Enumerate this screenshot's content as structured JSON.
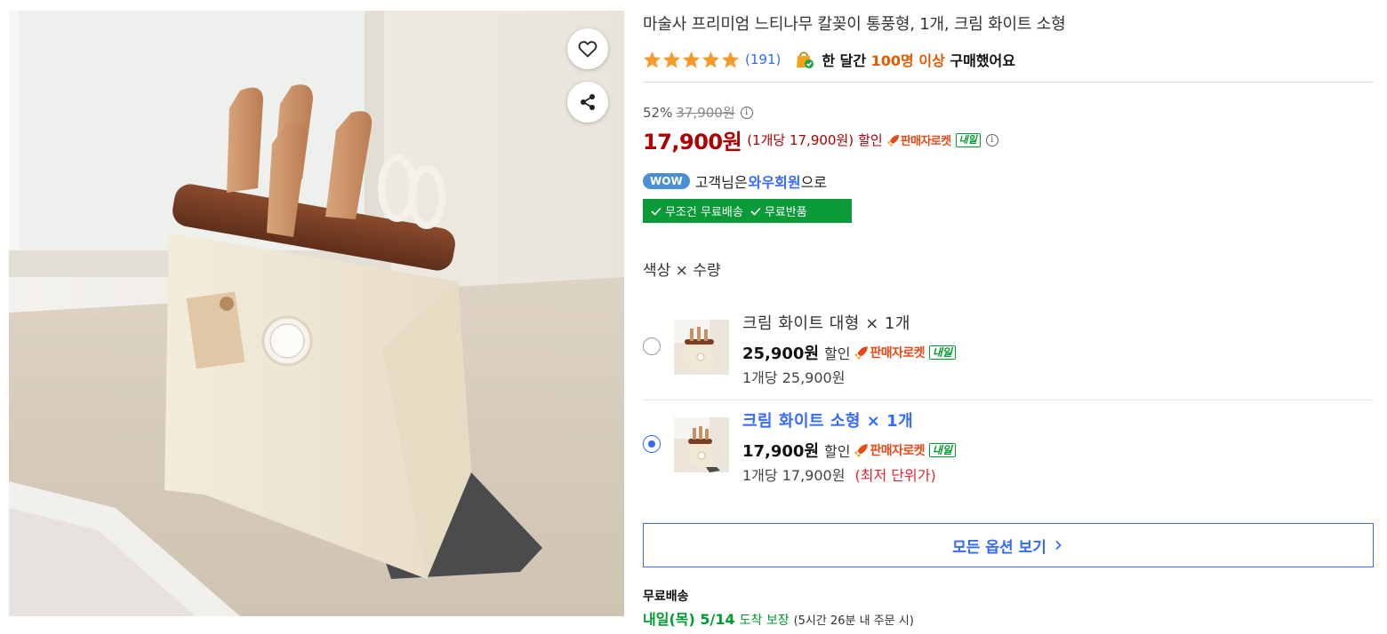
{
  "product": {
    "title": "마술사 프리미엄 느티나무 칼꽂이 통풍형, 1개, 크림 화이트 소형",
    "image_alt": "knife-block-product-photo"
  },
  "rating": {
    "stars": 5,
    "review_count": "(191)",
    "purchase_prefix": "한 달간",
    "purchase_highlight": "100명 이상",
    "purchase_suffix": "구매했어요"
  },
  "price": {
    "discount_rate": "52%",
    "original_price": "37,900원",
    "sale_price": "17,900원",
    "per_unit": "(1개당 17,900원)",
    "discount_word": "할인",
    "rocket_label": "판매자로켓",
    "tomorrow_badge": "내일"
  },
  "wow": {
    "badge": "WOW",
    "text_before": "고객님은",
    "text_highlight": "와우회원",
    "text_after": "으로",
    "benefit_1": "무조건 무료배송",
    "benefit_2": "무료반품"
  },
  "options": {
    "heading": "색상 × 수량",
    "items": [
      {
        "name": "크림 화이트 대형 × 1개",
        "price": "25,900원",
        "discount_word": "할인",
        "rocket_label": "판매자로켓",
        "tomorrow_badge": "내일",
        "unit_price": "1개당 25,900원",
        "note": "",
        "selected": false
      },
      {
        "name": "크림 화이트 소형 × 1개",
        "price": "17,900원",
        "discount_word": "할인",
        "rocket_label": "판매자로켓",
        "tomorrow_badge": "내일",
        "unit_price": "1개당 17,900원",
        "note": "(최저 단위가)",
        "selected": true
      }
    ],
    "view_all_label": "모든 옵션 보기"
  },
  "shipping": {
    "label": "무료배송",
    "date": "내일(목) 5/14",
    "guarantee": "도착 보장",
    "cutoff": "(5시간 26분 내 주문 시)"
  },
  "colors": {
    "price_red": "#ae0000",
    "link_blue": "#346aff",
    "rocket_orange": "#e84a17",
    "delivery_green": "#009b2e",
    "star_orange": "#f79a2c"
  }
}
